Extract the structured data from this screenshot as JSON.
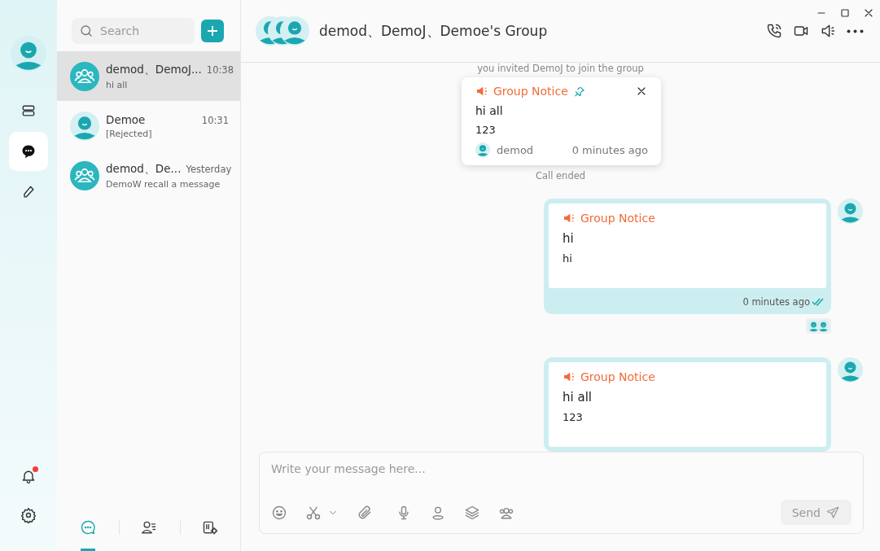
{
  "rail": {
    "items": [
      {
        "kind": "layers",
        "selected": false
      },
      {
        "kind": "chat",
        "selected": true
      },
      {
        "kind": "pen",
        "selected": false
      }
    ],
    "bell": {
      "unread": true
    }
  },
  "conversation_list": {
    "search": {
      "placeholder": "Search"
    },
    "items": [
      {
        "kind": "group",
        "name": "demod、DemoJ...",
        "time": "10:38",
        "preview": "hi all",
        "selected": true
      },
      {
        "kind": "person",
        "name": "Demoe",
        "time": "10:31",
        "preview": "[Rejected]",
        "selected": false
      },
      {
        "kind": "group",
        "name": "demod、De...",
        "time": "Yesterday",
        "preview": "DemoW recall a message",
        "selected": false
      }
    ],
    "tabs": [
      {
        "kind": "chats",
        "selected": true
      },
      {
        "kind": "contacts",
        "selected": false
      },
      {
        "kind": "workspace",
        "selected": false
      }
    ]
  },
  "chat": {
    "title": "demod、DemoJ、Demoe's Group",
    "system_messages": [
      "you invited DemoJ to join the group",
      "Call ended"
    ],
    "pinned_notice": {
      "title": "Group Notice",
      "pinned": true,
      "heading": "hi all",
      "body": "123",
      "author": "demod",
      "time": "0 minutes ago"
    },
    "messages": [
      {
        "kind": "notice",
        "title": "Group Notice",
        "heading": "hi",
        "body": "hi",
        "time": "0 minutes ago",
        "read": true
      },
      {
        "kind": "notice",
        "title": "Group Notice",
        "heading": "hi all",
        "body": "123"
      }
    ],
    "composer": {
      "placeholder": "Write your message here...",
      "send": {
        "label": "Send",
        "disabled": true
      }
    }
  }
}
